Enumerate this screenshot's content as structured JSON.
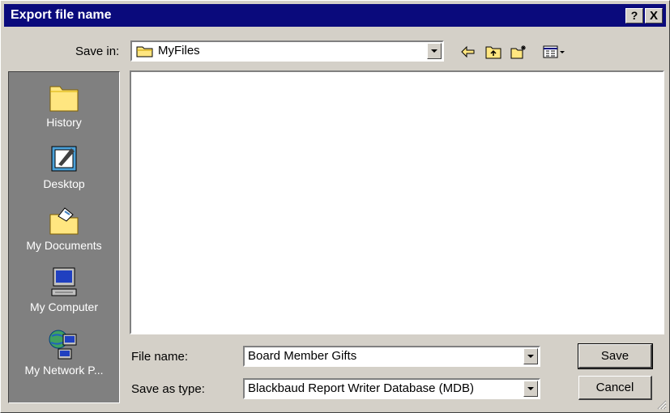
{
  "dialog": {
    "title": "Export file name",
    "help_label": "?",
    "close_label": "X"
  },
  "save_in": {
    "label": "Save in:",
    "value": "MyFiles"
  },
  "places": [
    {
      "label": "History",
      "icon": "history-folder-icon"
    },
    {
      "label": "Desktop",
      "icon": "desktop-icon"
    },
    {
      "label": "My Documents",
      "icon": "my-documents-folder-icon"
    },
    {
      "label": "My Computer",
      "icon": "computer-icon"
    },
    {
      "label": "My Network P...",
      "icon": "network-places-icon"
    }
  ],
  "file_name": {
    "label": "File name:",
    "value": "Board Member Gifts"
  },
  "save_as_type": {
    "label": "Save as type:",
    "value": "Blackbaud Report Writer Database (MDB)"
  },
  "buttons": {
    "save": "Save",
    "cancel": "Cancel"
  },
  "colors": {
    "titlebar": "#0a0a7c",
    "face": "#d4d0c8",
    "places_bar": "#808080"
  }
}
